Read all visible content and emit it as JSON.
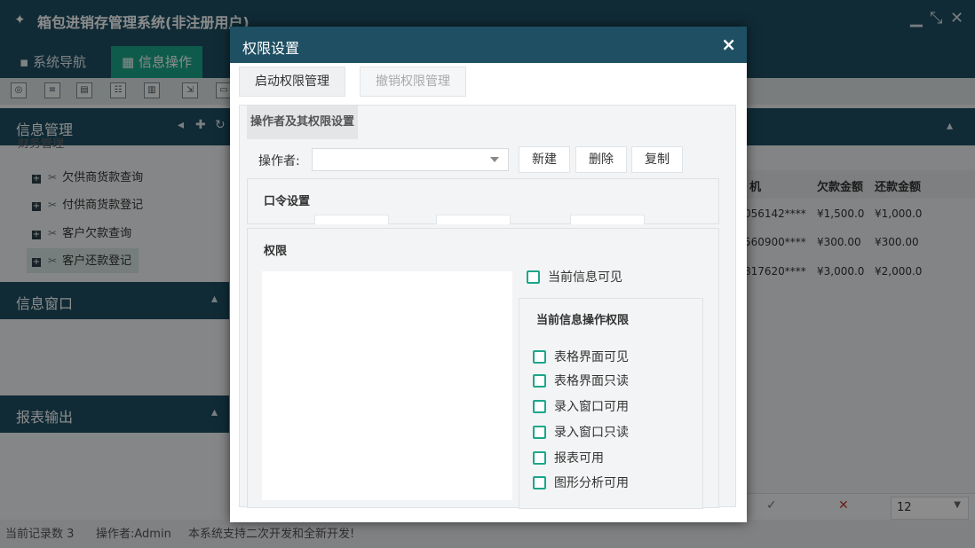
{
  "app": {
    "title": "箱包进销存管理系统(非注册用户)",
    "tabs": [
      {
        "label": "系统导航"
      },
      {
        "label": "信息操作"
      }
    ]
  },
  "left": {
    "panels": [
      {
        "title": "信息管理"
      },
      {
        "title": "信息窗口"
      },
      {
        "title": "报表输出"
      }
    ],
    "tree_partial": "财务管理",
    "tree_items": [
      {
        "label": "欠供商货款查询"
      },
      {
        "label": "付供商货款登记"
      },
      {
        "label": "客户欠款查询"
      },
      {
        "label": "客户还款登记"
      }
    ]
  },
  "grid": {
    "headers": [
      "机",
      "欠款金额",
      "还款金额"
    ],
    "rows": [
      {
        "phone": "056142****",
        "debt": "¥1,500.0",
        "repay": "¥1,000.0"
      },
      {
        "phone": "560900****",
        "debt": "¥300.00",
        "repay": "¥300.00"
      },
      {
        "phone": "817620****",
        "debt": "¥3,000.0",
        "repay": "¥2,000.0"
      }
    ],
    "page_size": "12"
  },
  "status": {
    "records": "当前记录数 3",
    "operator": "操作者:Admin",
    "note": "本系统支持二次开发和全新开发!"
  },
  "dialog": {
    "title": "权限设置",
    "enable_btn": "启动权限管理",
    "revoke_btn": "撤销权限管理",
    "section_tab": "操作者及其权限设置",
    "operator_label": "操作者:",
    "operator_value": "",
    "new_btn": "新建",
    "delete_btn": "删除",
    "copy_btn": "复制",
    "password_title": "口令设置",
    "perm_title": "权限",
    "current_visible": "当前信息可见",
    "ops_title": "当前信息操作权限",
    "ops": [
      {
        "label": "表格界面可见"
      },
      {
        "label": "表格界面只读"
      },
      {
        "label": "录入窗口可用"
      },
      {
        "label": "录入窗口只读"
      },
      {
        "label": "报表可用"
      },
      {
        "label": "图形分析可用"
      }
    ]
  }
}
